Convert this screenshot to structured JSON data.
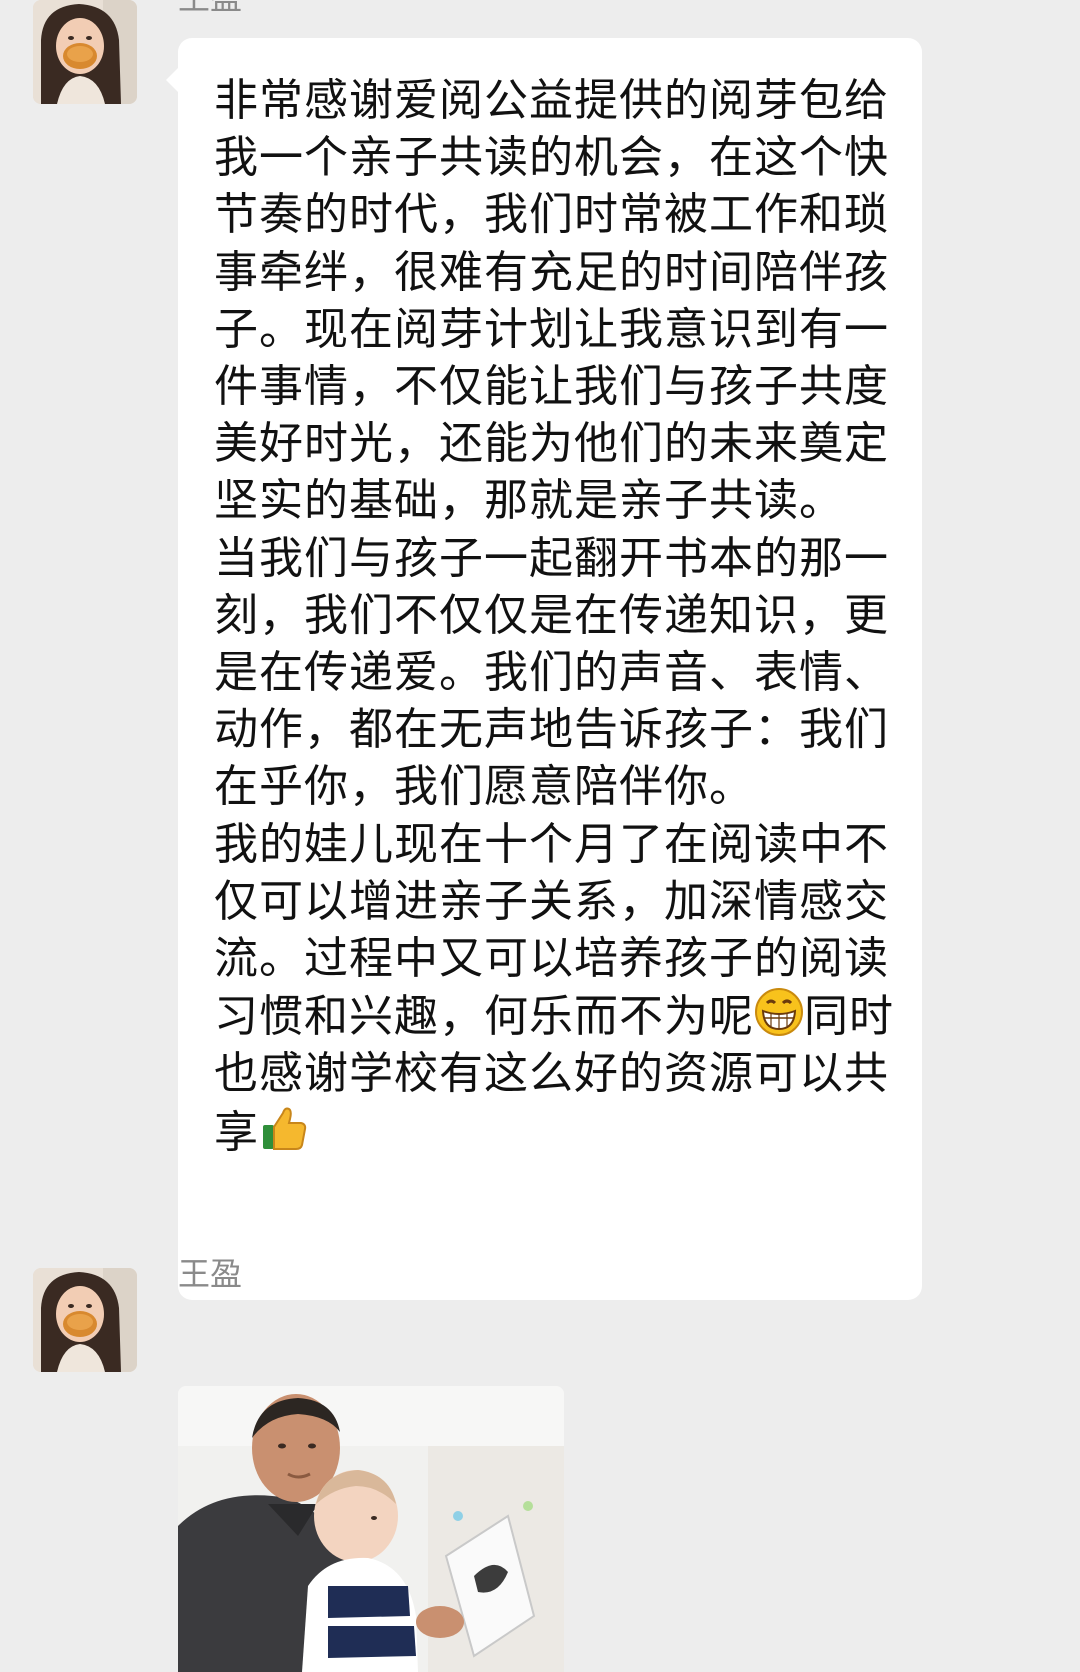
{
  "messages": [
    {
      "sender": "王盈",
      "avatar_icon": "girl-eating-avatar",
      "paragraphs": [
        "非常感谢爱阅公益提供的阅芽包给我一个亲子共读的机会，在这个快节奏的时代，我们时常被工作和琐事牵绊，很难有充足的时间陪伴孩子。现在阅芽计划让我意识到有一件事情，不仅能让我们与孩子共度美好时光，还能为他们的未来奠定坚实的基础，那就是亲子共读。",
        "当我们与孩子一起翻开书本的那一刻，我们不仅仅是在传递知识，更是在传递爱。我们的声音、表情、动作，都在无声地告诉孩子：我们在乎你，我们愿意陪伴你。",
        "我的娃儿现在十个月了在阅读中不仅可以增进亲子关系，加深情感交流。过程中又可以培养孩子的阅读习惯和兴趣，何乐而不为呢"
      ],
      "tail_text_1": "同时也感谢学校有这么好的资源可以共享",
      "emoji_1": "grinning-face-emoji",
      "emoji_2": "thumbs-up-emoji"
    },
    {
      "sender": "王盈",
      "avatar_icon": "girl-eating-avatar",
      "image_icon": "man-reading-to-baby-photo"
    }
  ],
  "colors": {
    "background": "#ededed",
    "bubble": "#ffffff",
    "text": "#111111",
    "sender": "#8a8a8a"
  }
}
